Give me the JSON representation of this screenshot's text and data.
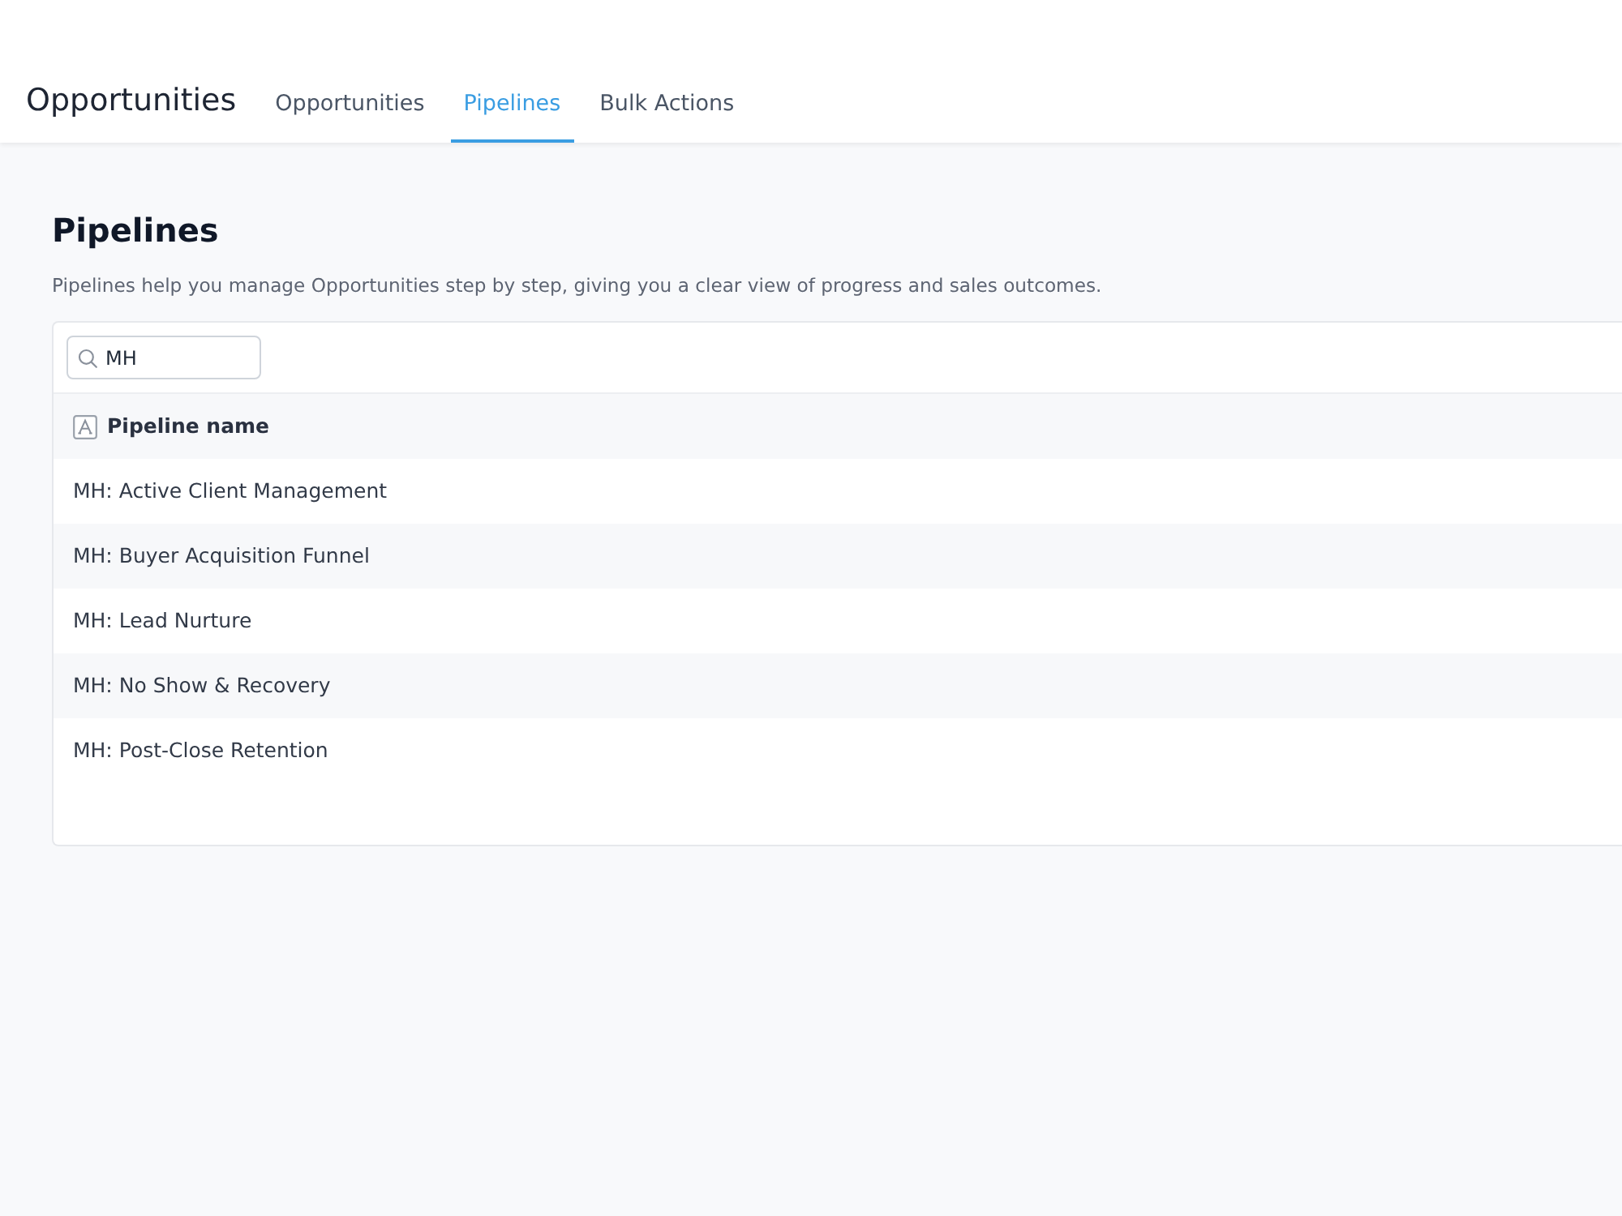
{
  "header": {
    "title": "Opportunities"
  },
  "tabs": [
    {
      "label": "Opportunities",
      "selected": false
    },
    {
      "label": "Pipelines",
      "selected": true
    },
    {
      "label": "Bulk Actions",
      "selected": false
    }
  ],
  "page": {
    "title": "Pipelines",
    "description": "Pipelines help you manage Opportunities step by step, giving you a clear view of progress and sales outcomes."
  },
  "search": {
    "value": "MH"
  },
  "table": {
    "columns": [
      {
        "label": "Pipeline name"
      }
    ],
    "rows": [
      "MH: Active Client Management",
      "MH: Buyer Acquisition Funnel",
      "MH: Lead Nurture",
      "MH: No Show & Recovery",
      "MH: Post-Close Retention"
    ]
  }
}
